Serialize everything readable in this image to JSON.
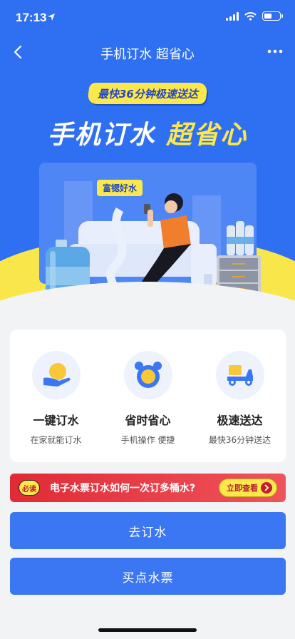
{
  "status": {
    "time": "17:13"
  },
  "nav": {
    "title": "手机订水 超省心"
  },
  "hero": {
    "badge": "最快36分钟极速送达",
    "headline_white": "手机订水",
    "headline_yellow": "超省心",
    "scene_tag": "富锶好水"
  },
  "features": [
    {
      "title": "一键订水",
      "subtitle": "在家就能订水",
      "icon": "hand-sun-icon"
    },
    {
      "title": "省时省心",
      "subtitle": "手机操作 便捷",
      "icon": "alarm-clock-icon"
    },
    {
      "title": "极速送达",
      "subtitle": "最快36分钟送达",
      "icon": "delivery-scooter-icon"
    }
  ],
  "banner": {
    "badge": "必读",
    "text": "电子水票订水如何一次订多桶水?",
    "button": "立即查看"
  },
  "buttons": {
    "order": "去订水",
    "ticket": "买点水票"
  },
  "colors": {
    "primary": "#3b76f3",
    "hero_bg": "#2f6ff2",
    "accent_yellow": "#fde84b",
    "banner_red": "#e02b36"
  }
}
